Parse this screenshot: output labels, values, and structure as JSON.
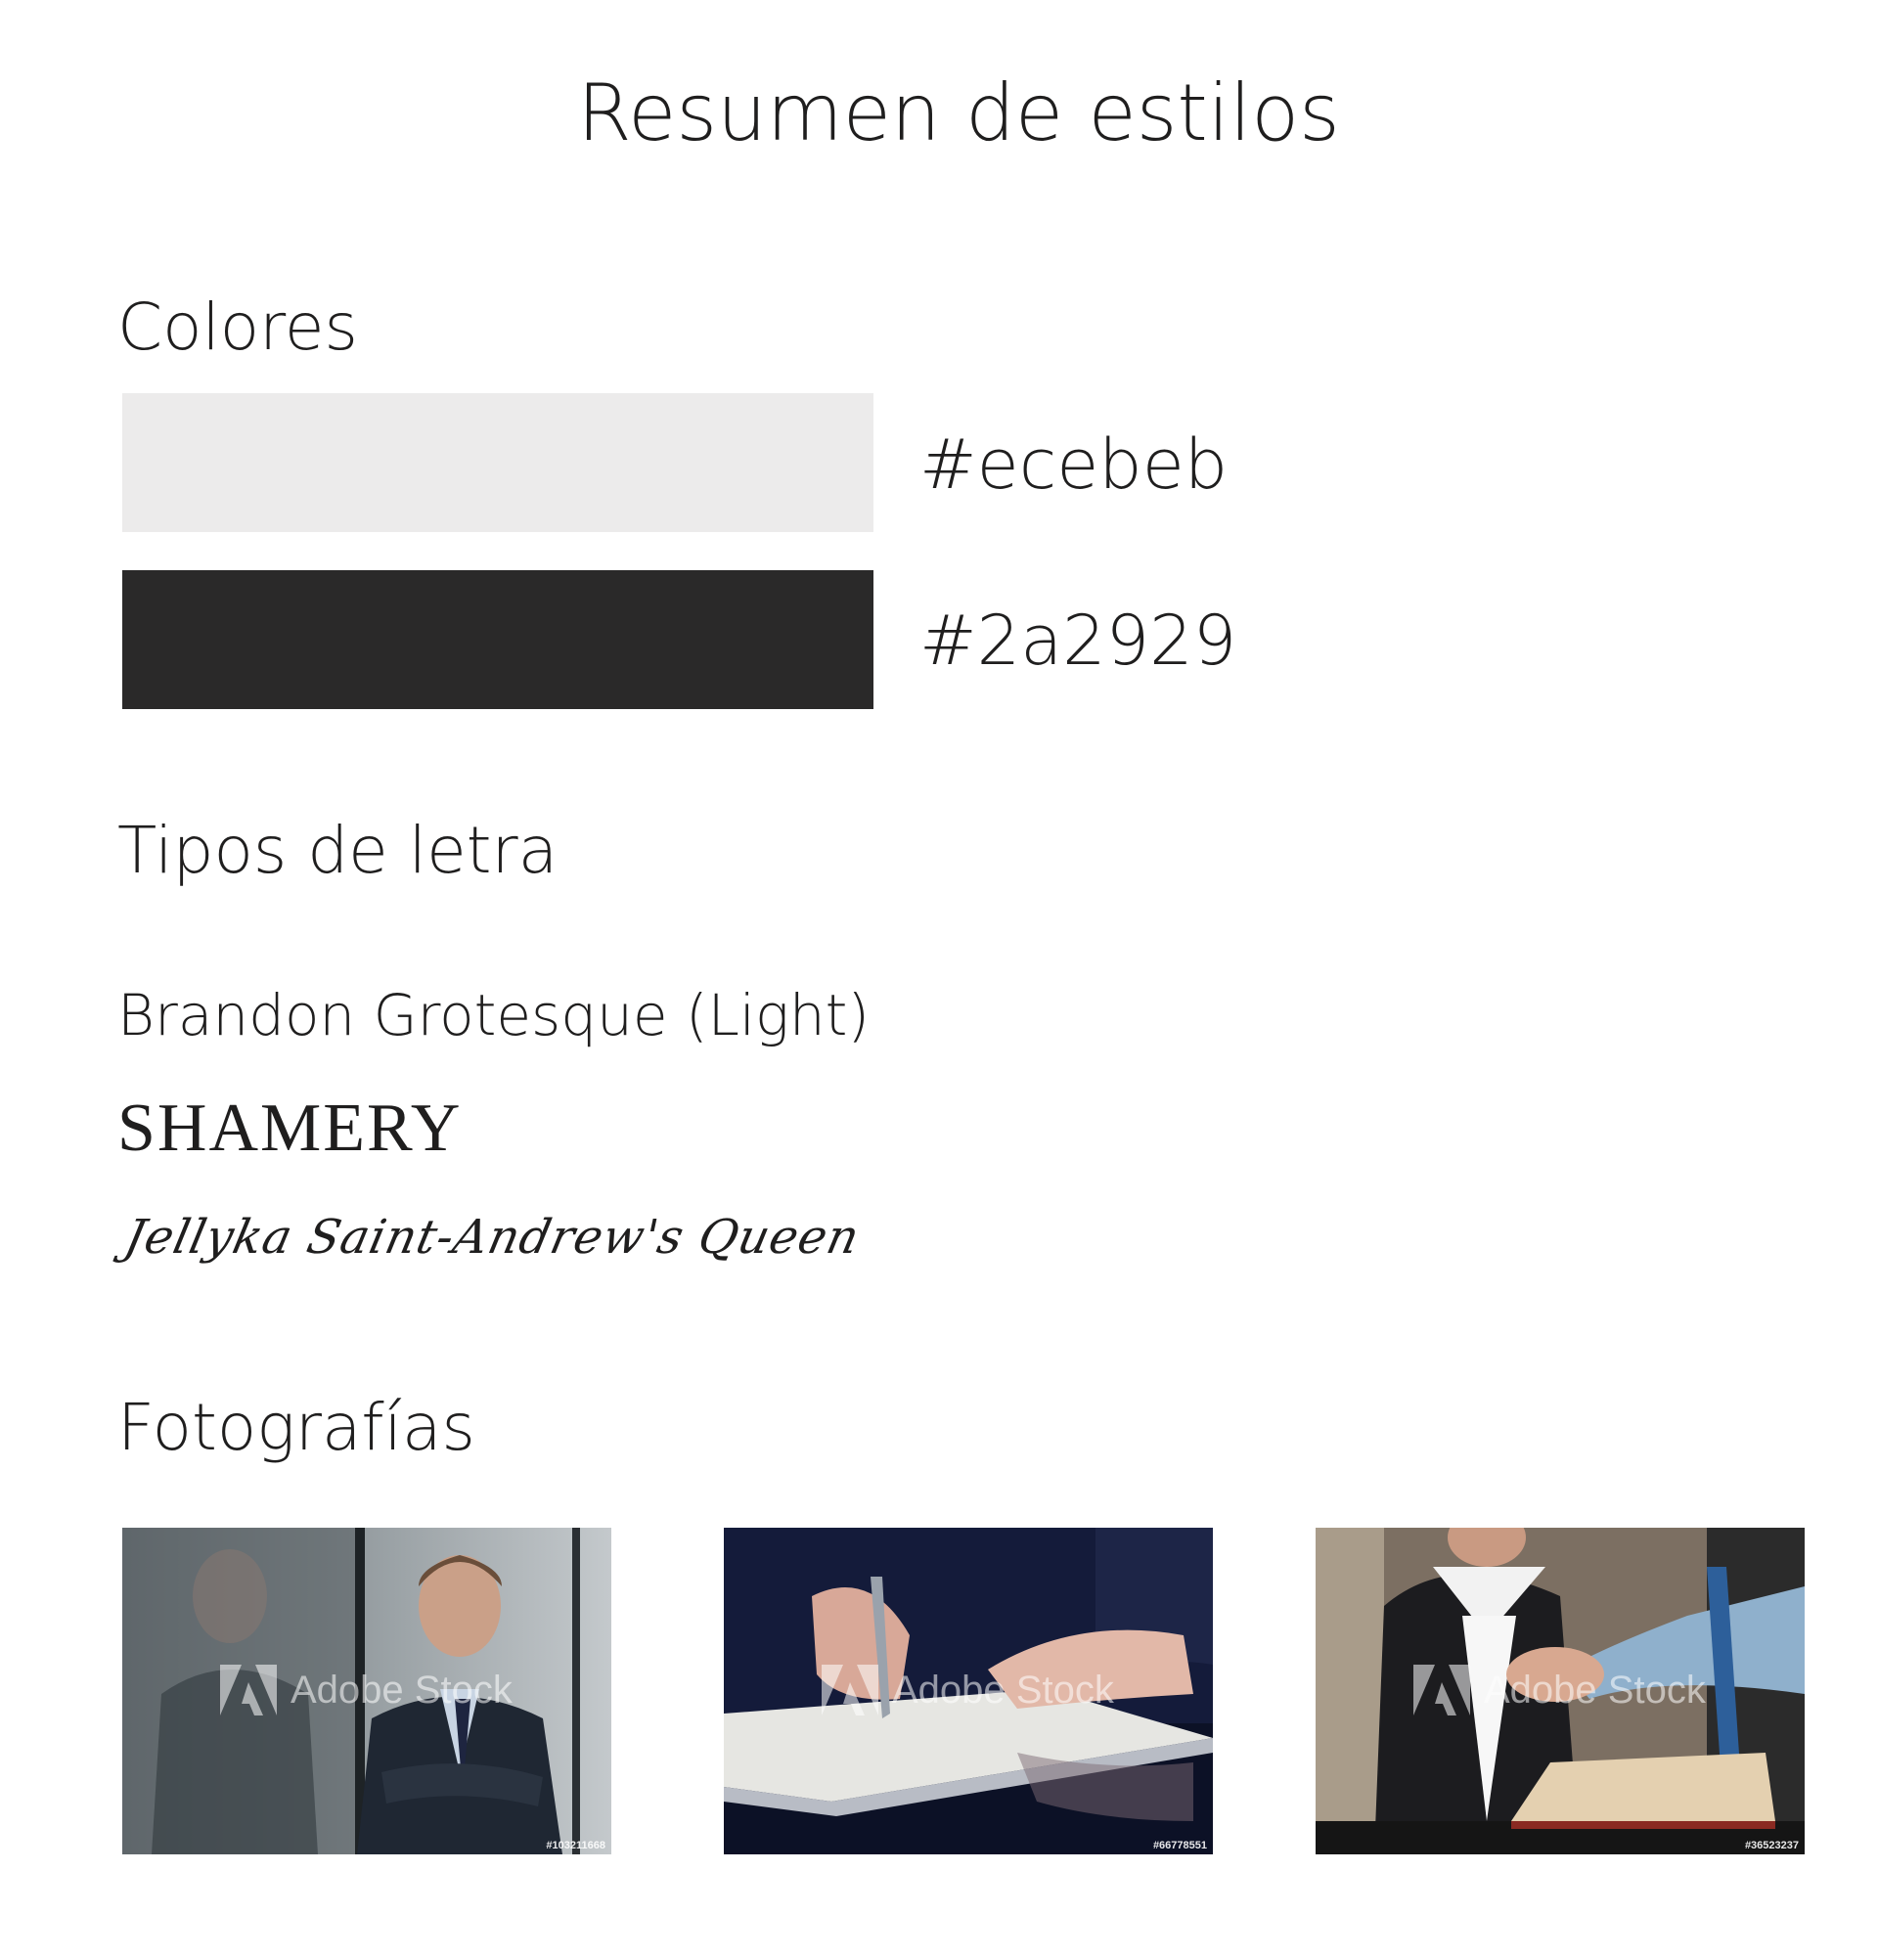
{
  "page": {
    "title": "Resumen de estilos"
  },
  "sections": {
    "colors_heading": "Colores",
    "fonts_heading": "Tipos de letra",
    "photos_heading": "Fotografías"
  },
  "colors": [
    {
      "hex": "#ecebeb",
      "label": "#ecebeb"
    },
    {
      "hex": "#2a2929",
      "label": "#2a2929"
    }
  ],
  "fonts": [
    "Brandon Grotesque (Light)",
    "SHAMERY",
    "Jellyka Saint-Andrew's Queen"
  ],
  "photos": [
    {
      "subject": "businessman-portrait",
      "id": "#103211668",
      "watermark": "Adobe Stock"
    },
    {
      "subject": "signing-document",
      "id": "#66778551",
      "watermark": "Adobe Stock"
    },
    {
      "subject": "handshake",
      "id": "#36523237",
      "watermark": "Adobe Stock"
    }
  ]
}
